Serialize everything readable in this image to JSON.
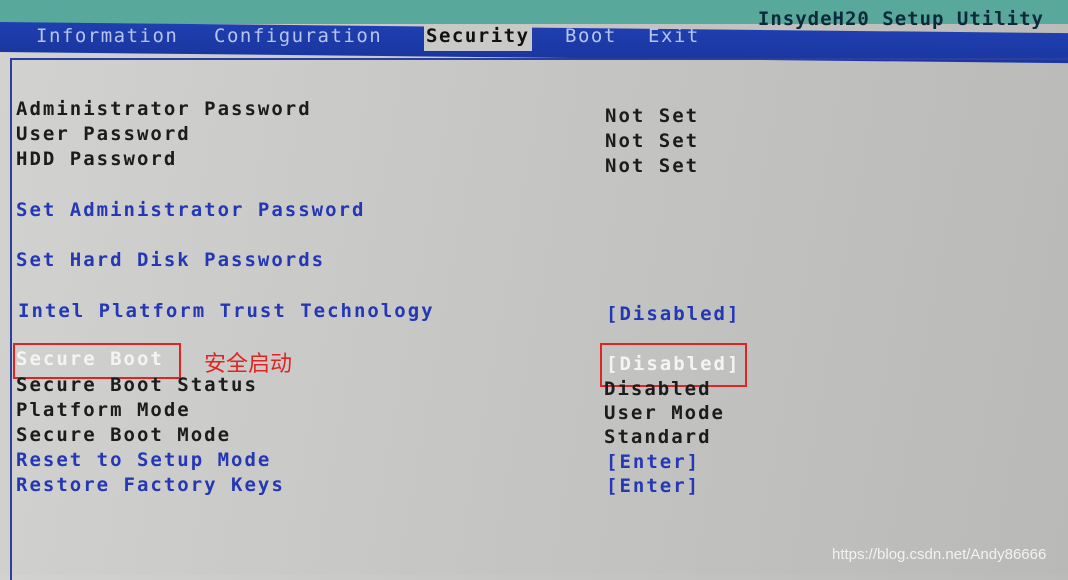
{
  "header": {
    "title": "InsydeH20 Setup Utility"
  },
  "tabs": [
    {
      "label": "Information"
    },
    {
      "label": "Configuration"
    },
    {
      "label": "Security",
      "active": true
    },
    {
      "label": "Boot"
    },
    {
      "label": "Exit"
    }
  ],
  "items": [
    {
      "label": "Administrator Password",
      "value": "Not Set"
    },
    {
      "label": "User Password",
      "value": "Not Set"
    },
    {
      "label": "HDD Password",
      "value": "Not Set"
    },
    {
      "label": "Set Administrator Password"
    },
    {
      "label": "Set Hard Disk Passwords"
    },
    {
      "label": "Intel Platform Trust Technology",
      "value": "[Disabled]"
    },
    {
      "label": "Secure Boot",
      "value": "[Disabled]",
      "selected": true
    },
    {
      "label": "Secure Boot Status",
      "value": "Disabled"
    },
    {
      "label": "Platform Mode",
      "value": "User Mode"
    },
    {
      "label": "Secure Boot Mode",
      "value": "Standard"
    },
    {
      "label": "Reset to Setup Mode",
      "value": "[Enter]"
    },
    {
      "label": "Restore Factory Keys",
      "value": "[Enter]"
    }
  ],
  "annotation": {
    "text": "安全启动",
    "color": "#e02424"
  },
  "watermark": "https://blog.csdn.net/Andy86666",
  "colors": {
    "menu_bar": "#1f3fb0",
    "top_band": "#58a89c",
    "selectable": "#2437b4",
    "highlight": "#f4f4f4"
  }
}
